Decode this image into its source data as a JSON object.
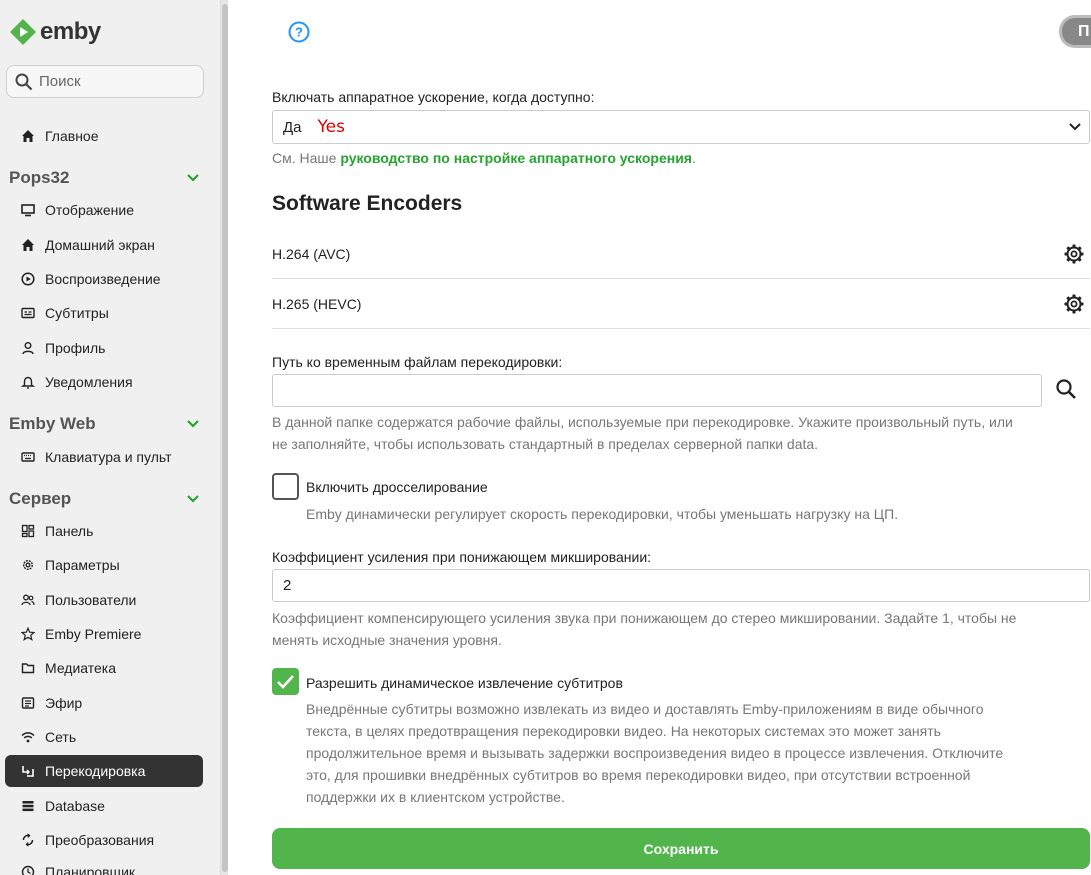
{
  "app": {
    "logo_text": "emby",
    "brand_color": "#52b54b"
  },
  "search": {
    "placeholder": "Поиск"
  },
  "sidebar": {
    "home": "Главное",
    "sections": [
      {
        "title": "Pops32",
        "items": [
          "Отображение",
          "Домашний экран",
          "Воспроизведение",
          "Субтитры",
          "Профиль",
          "Уведомления"
        ]
      },
      {
        "title": "Emby Web",
        "items": [
          "Клавиатура и пульт"
        ]
      },
      {
        "title": "Сервер",
        "items": [
          "Панель",
          "Параметры",
          "Пользователи",
          "Emby Premiere",
          "Медиатека",
          "Эфир",
          "Сеть",
          "Перекодировка",
          "Database",
          "Преобразования",
          "Планировщик"
        ]
      }
    ],
    "active_item": "Перекодировка"
  },
  "top": {
    "pill_text": "П"
  },
  "hw_accel": {
    "label": "Включать аппаратное ускорение, когда доступно:",
    "value": "Да",
    "annotation": "Yes",
    "hint_prefix": "См. Наше ",
    "hint_link": "руководство по настройке аппаратного ускорения",
    "hint_suffix": "."
  },
  "software_encoders": {
    "title": "Software Encoders",
    "rows": [
      "H.264 (AVC)",
      "H.265 (HEVC)"
    ]
  },
  "temp_path": {
    "label": "Путь ко временным файлам перекодировки:",
    "value": "",
    "hint_line1": "В данной папке содержатся рабочие файлы, используемые при перекодировке. Укажите произвольный путь, или",
    "hint_line2": "не заполняйте, чтобы использовать стандартный в пределах серверной папки data."
  },
  "throttling": {
    "label": "Включить дросселирование",
    "checked": false,
    "hint": "Emby динамически регулирует скорость перекодировки, чтобы уменьшать нагрузку на ЦП."
  },
  "downmix": {
    "label": "Коэффициент усиления при понижающем микшировании:",
    "value": "2",
    "hint_line1": "Коэффициент компенсирующего усиления звука при понижающем до стерео микшировании. Задайте 1, чтобы не",
    "hint_line2": "менять исходные значения уровня."
  },
  "subtitles": {
    "label": "Разрешить динамическое извлечение субтитров",
    "checked": true,
    "hint_lines": [
      "Внедрённые субтитры возможно извлекать из видео и доставлять Emby-приложениям в виде обычного",
      "текста, в целях предотвращения перекодировки видео. На некоторых системах это может занять",
      "продолжительное время и вызывать задержки воспроизведения видео в процессе извлечения. Отключите",
      "это, для прошивки внедрённых субтитров во время перекодировки видео, при отсутствии встроенной",
      "поддержки их в клиентском устройстве."
    ]
  },
  "save_label": "Сохранить"
}
